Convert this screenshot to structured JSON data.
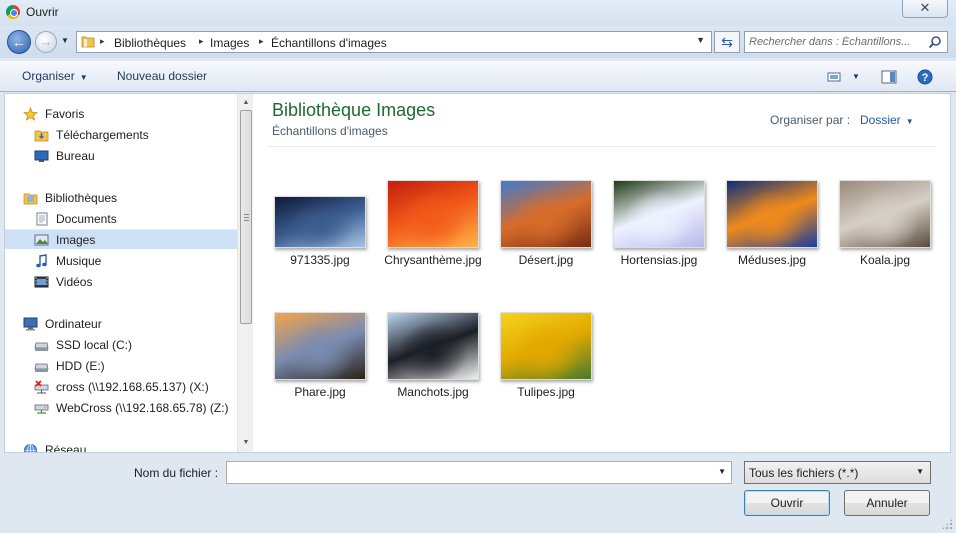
{
  "window": {
    "title": "Ouvrir",
    "close_glyph": "✕"
  },
  "address": {
    "breadcrumbs": [
      "Bibliothèques",
      "Images",
      "Échantillons d'images"
    ],
    "search_placeholder": "Rechercher dans : Échantillons..."
  },
  "toolbar": {
    "organize_label": "Organiser",
    "new_folder_label": "Nouveau dossier"
  },
  "nav": {
    "items": [
      {
        "label": "Favoris",
        "icon": "star-icon",
        "level": 0
      },
      {
        "label": "Téléchargements",
        "icon": "downloads-folder-icon",
        "level": 1
      },
      {
        "label": "Bureau",
        "icon": "desktop-icon",
        "level": 1
      },
      {
        "label": "Bibliothèques",
        "icon": "libraries-icon",
        "level": 0
      },
      {
        "label": "Documents",
        "icon": "documents-icon",
        "level": 1
      },
      {
        "label": "Images",
        "icon": "pictures-icon",
        "level": 1,
        "selected": true
      },
      {
        "label": "Musique",
        "icon": "music-icon",
        "level": 1
      },
      {
        "label": "Vidéos",
        "icon": "videos-icon",
        "level": 1
      },
      {
        "label": "Ordinateur",
        "icon": "computer-icon",
        "level": 0
      },
      {
        "label": "SSD local (C:)",
        "icon": "drive-icon",
        "level": 1
      },
      {
        "label": "HDD (E:)",
        "icon": "drive-icon",
        "level": 1
      },
      {
        "label": "cross (\\\\192.168.65.137) (X:)",
        "icon": "disconnected-network-drive-icon",
        "level": 1
      },
      {
        "label": "WebCross (\\\\192.168.65.78) (Z:)",
        "icon": "network-drive-icon",
        "level": 1
      },
      {
        "label": "Réseau",
        "icon": "network-icon",
        "level": 0
      }
    ]
  },
  "content": {
    "title": "Bibliothèque Images",
    "subtitle": "Échantillons d'images",
    "arrange_label": "Organiser par :",
    "arrange_value": "Dossier",
    "files": [
      {
        "name": "971335.jpg",
        "colors": [
          "#0d1a3a",
          "#3b5c8f",
          "#a8c3e6"
        ]
      },
      {
        "name": "Chrysanthème.jpg",
        "colors": [
          "#c41e0c",
          "#f25a1a",
          "#ffb347"
        ]
      },
      {
        "name": "Désert.jpg",
        "colors": [
          "#3e7bd1",
          "#d86c2a",
          "#7a2d12"
        ]
      },
      {
        "name": "Hortensias.jpg",
        "colors": [
          "#1f3a14",
          "#eef2ff",
          "#b7b8e8"
        ]
      },
      {
        "name": "Méduses.jpg",
        "colors": [
          "#0a2f7a",
          "#f08a1c",
          "#1a3f9e"
        ]
      },
      {
        "name": "Koala.jpg",
        "colors": [
          "#9a8a7c",
          "#d6cfc5",
          "#5b4d40"
        ]
      },
      {
        "name": "Phare.jpg",
        "colors": [
          "#f4a34b",
          "#7a8cb0",
          "#2b2218"
        ]
      },
      {
        "name": "Manchots.jpg",
        "colors": [
          "#bcd6ef",
          "#1b1e25",
          "#f2f2f2"
        ]
      },
      {
        "name": "Tulipes.jpg",
        "colors": [
          "#f7d21c",
          "#e2a900",
          "#4a7a2a"
        ]
      }
    ]
  },
  "footer": {
    "filename_label": "Nom du fichier :",
    "filename_value": "",
    "filter_value": "Tous les fichiers (*.*)",
    "open_label": "Ouvrir",
    "cancel_label": "Annuler"
  },
  "colors": {
    "accent_title": "#1e6a2e",
    "link": "#1e5aa8",
    "selection": "#cde1f6"
  }
}
